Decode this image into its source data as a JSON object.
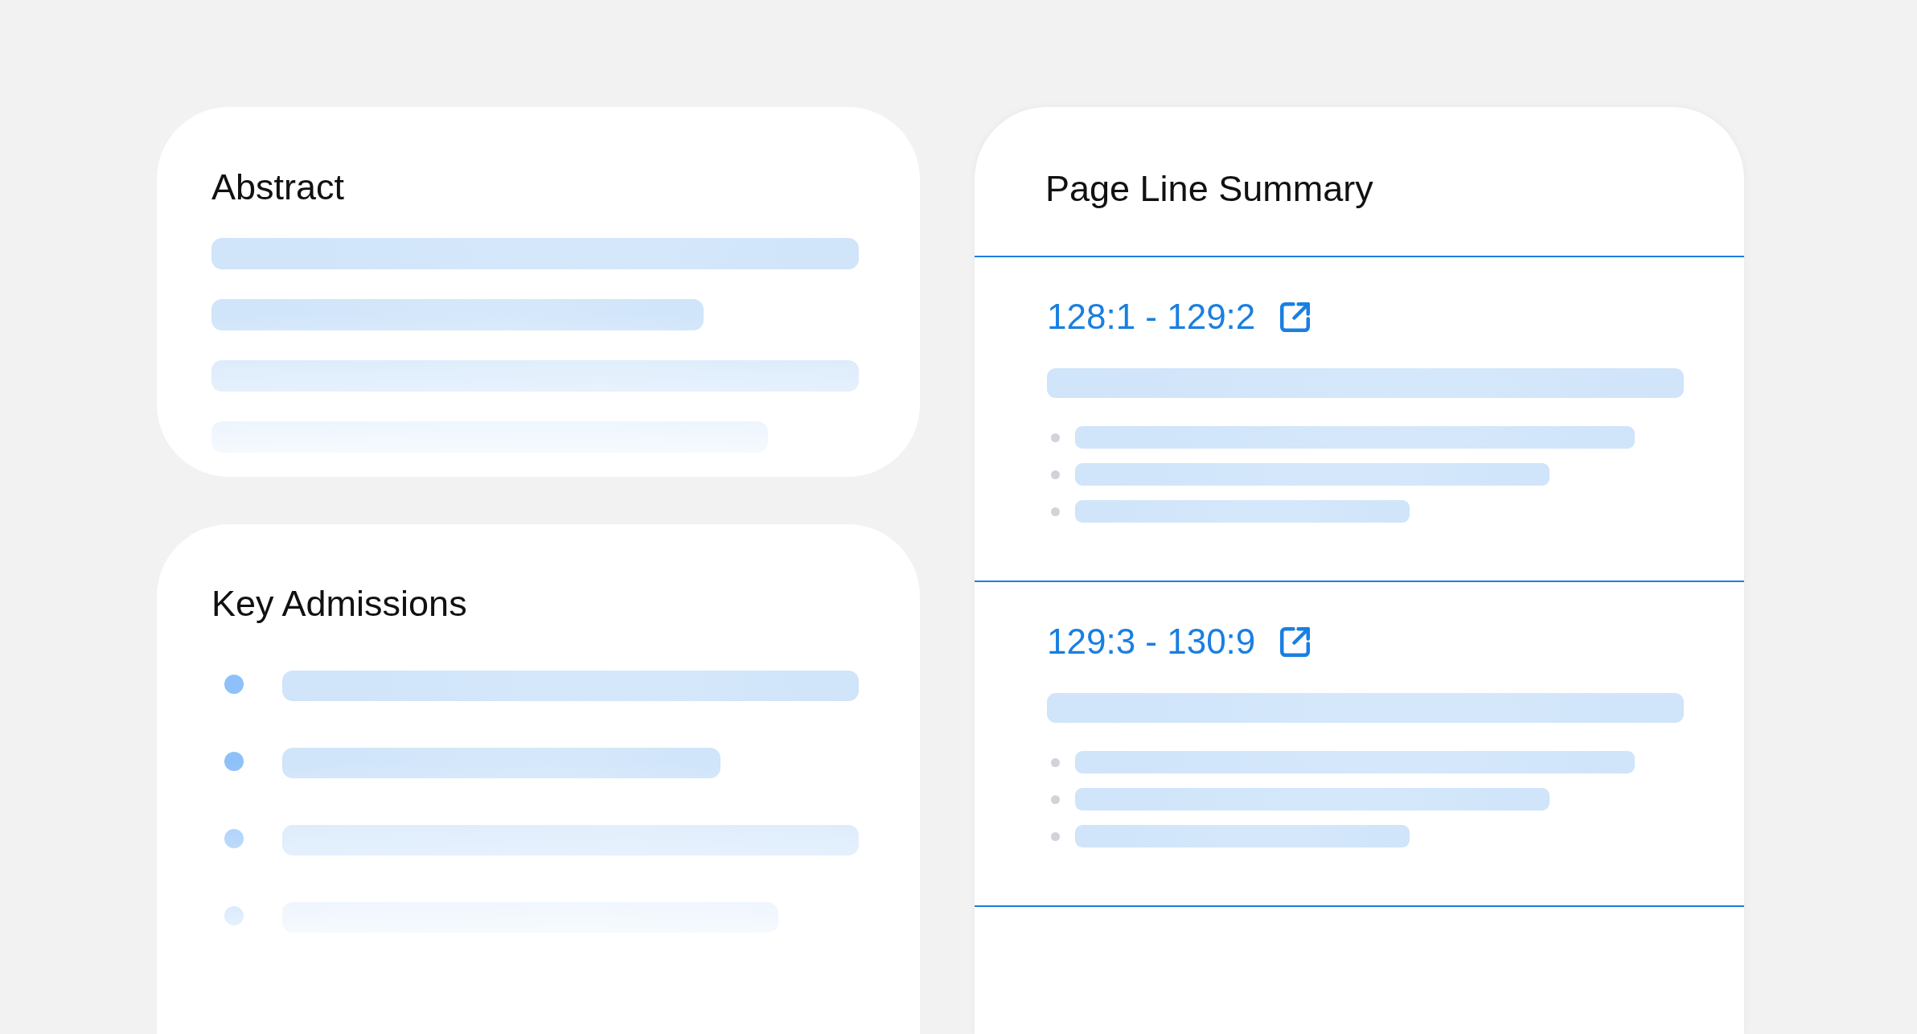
{
  "abstract": {
    "title": "Abstract",
    "loading": true
  },
  "key_admissions": {
    "title": "Key Admissions",
    "loading": true
  },
  "page_line_summary": {
    "title": "Page Line Summary",
    "entries": [
      {
        "range": "128:1 - 129:2",
        "loading": true
      },
      {
        "range": "129:3 - 130:9",
        "loading": true
      }
    ]
  }
}
